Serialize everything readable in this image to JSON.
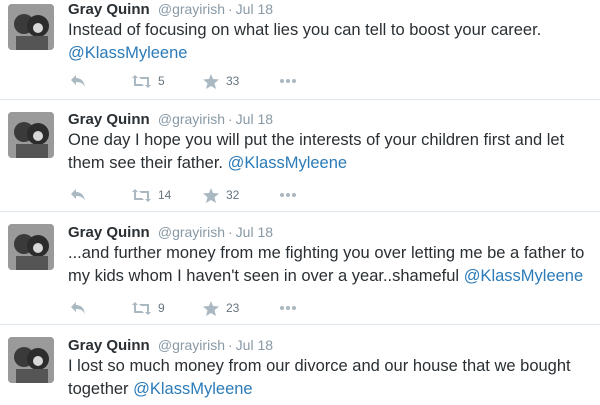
{
  "tweets": [
    {
      "name": "Gray Quinn",
      "handle": "@grayirish",
      "separator": "·",
      "date": "Jul 18",
      "text_lines": [
        "Instead of focusing on what lies you can tell to boost your career."
      ],
      "mention": "@KlassMyleene",
      "retweets": "5",
      "favorites": "33"
    },
    {
      "name": "Gray Quinn",
      "handle": "@grayirish",
      "separator": "·",
      "date": "Jul 18",
      "text_lines": [
        "One day I hope you will put the interests of your children first and let",
        "them see their father."
      ],
      "mention": "@KlassMyleene",
      "retweets": "14",
      "favorites": "32"
    },
    {
      "name": "Gray Quinn",
      "handle": "@grayirish",
      "separator": "·",
      "date": "Jul 18",
      "text_lines": [
        "...and further money from me fighting you over letting me be a father to",
        "my kids whom I haven't seen in over a year..shameful"
      ],
      "mention": "@KlassMyleene",
      "retweets": "9",
      "favorites": "23"
    },
    {
      "name": "Gray Quinn",
      "handle": "@grayirish",
      "separator": "·",
      "date": "Jul 18",
      "text_lines": [
        "I lost so much money from our divorce and our house that we bought",
        "together"
      ],
      "mention": "@KlassMyleene"
    }
  ],
  "colors": {
    "link": "#2b7bb9",
    "muted": "#8899a6",
    "text": "#292f33",
    "divider": "#e1e8ed"
  },
  "icons": [
    "reply-icon",
    "retweet-icon",
    "favorite-star-icon",
    "more-dots-icon"
  ]
}
